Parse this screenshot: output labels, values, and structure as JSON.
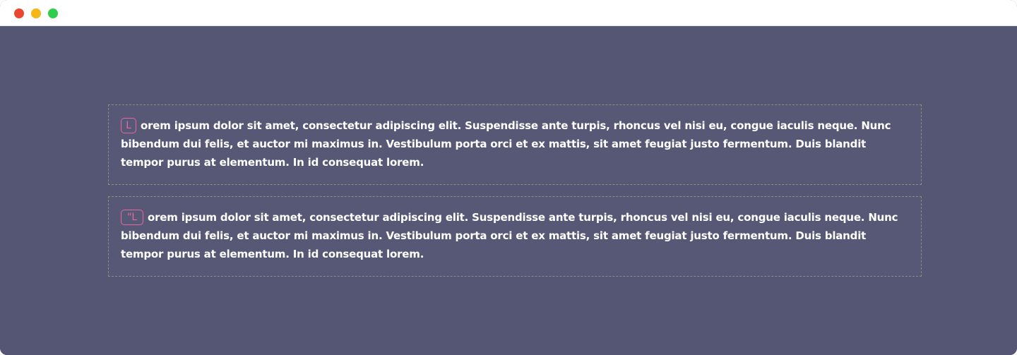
{
  "window": {
    "controls": {
      "close": "close",
      "minimize": "minimize",
      "zoom": "zoom"
    }
  },
  "boxes": [
    {
      "cap": "L",
      "text": "orem ipsum dolor sit amet, consectetur adipiscing elit. Suspendisse ante turpis, rhoncus vel nisi eu, congue iaculis neque. Nunc bibendum dui felis, et auctor mi maximus in. Vestibulum porta orci et ex mattis, sit amet feugiat justo fermentum. Duis blandit tempor purus at elementum. In id consequat lorem."
    },
    {
      "cap": "\"L",
      "text": "orem ipsum dolor sit amet, consectetur adipiscing elit. Suspendisse ante turpis, rhoncus vel nisi eu, congue iaculis neque. Nunc bibendum dui felis, et auctor mi maximus in. Vestibulum porta orci et ex mattis, sit amet feugiat justo fermentum. Duis blandit tempor purus at elementum. In id consequat lorem."
    }
  ],
  "colors": {
    "background": "#545674",
    "accent": "#e7679f",
    "text": "#ffffff",
    "border": "#8a8f7c"
  }
}
